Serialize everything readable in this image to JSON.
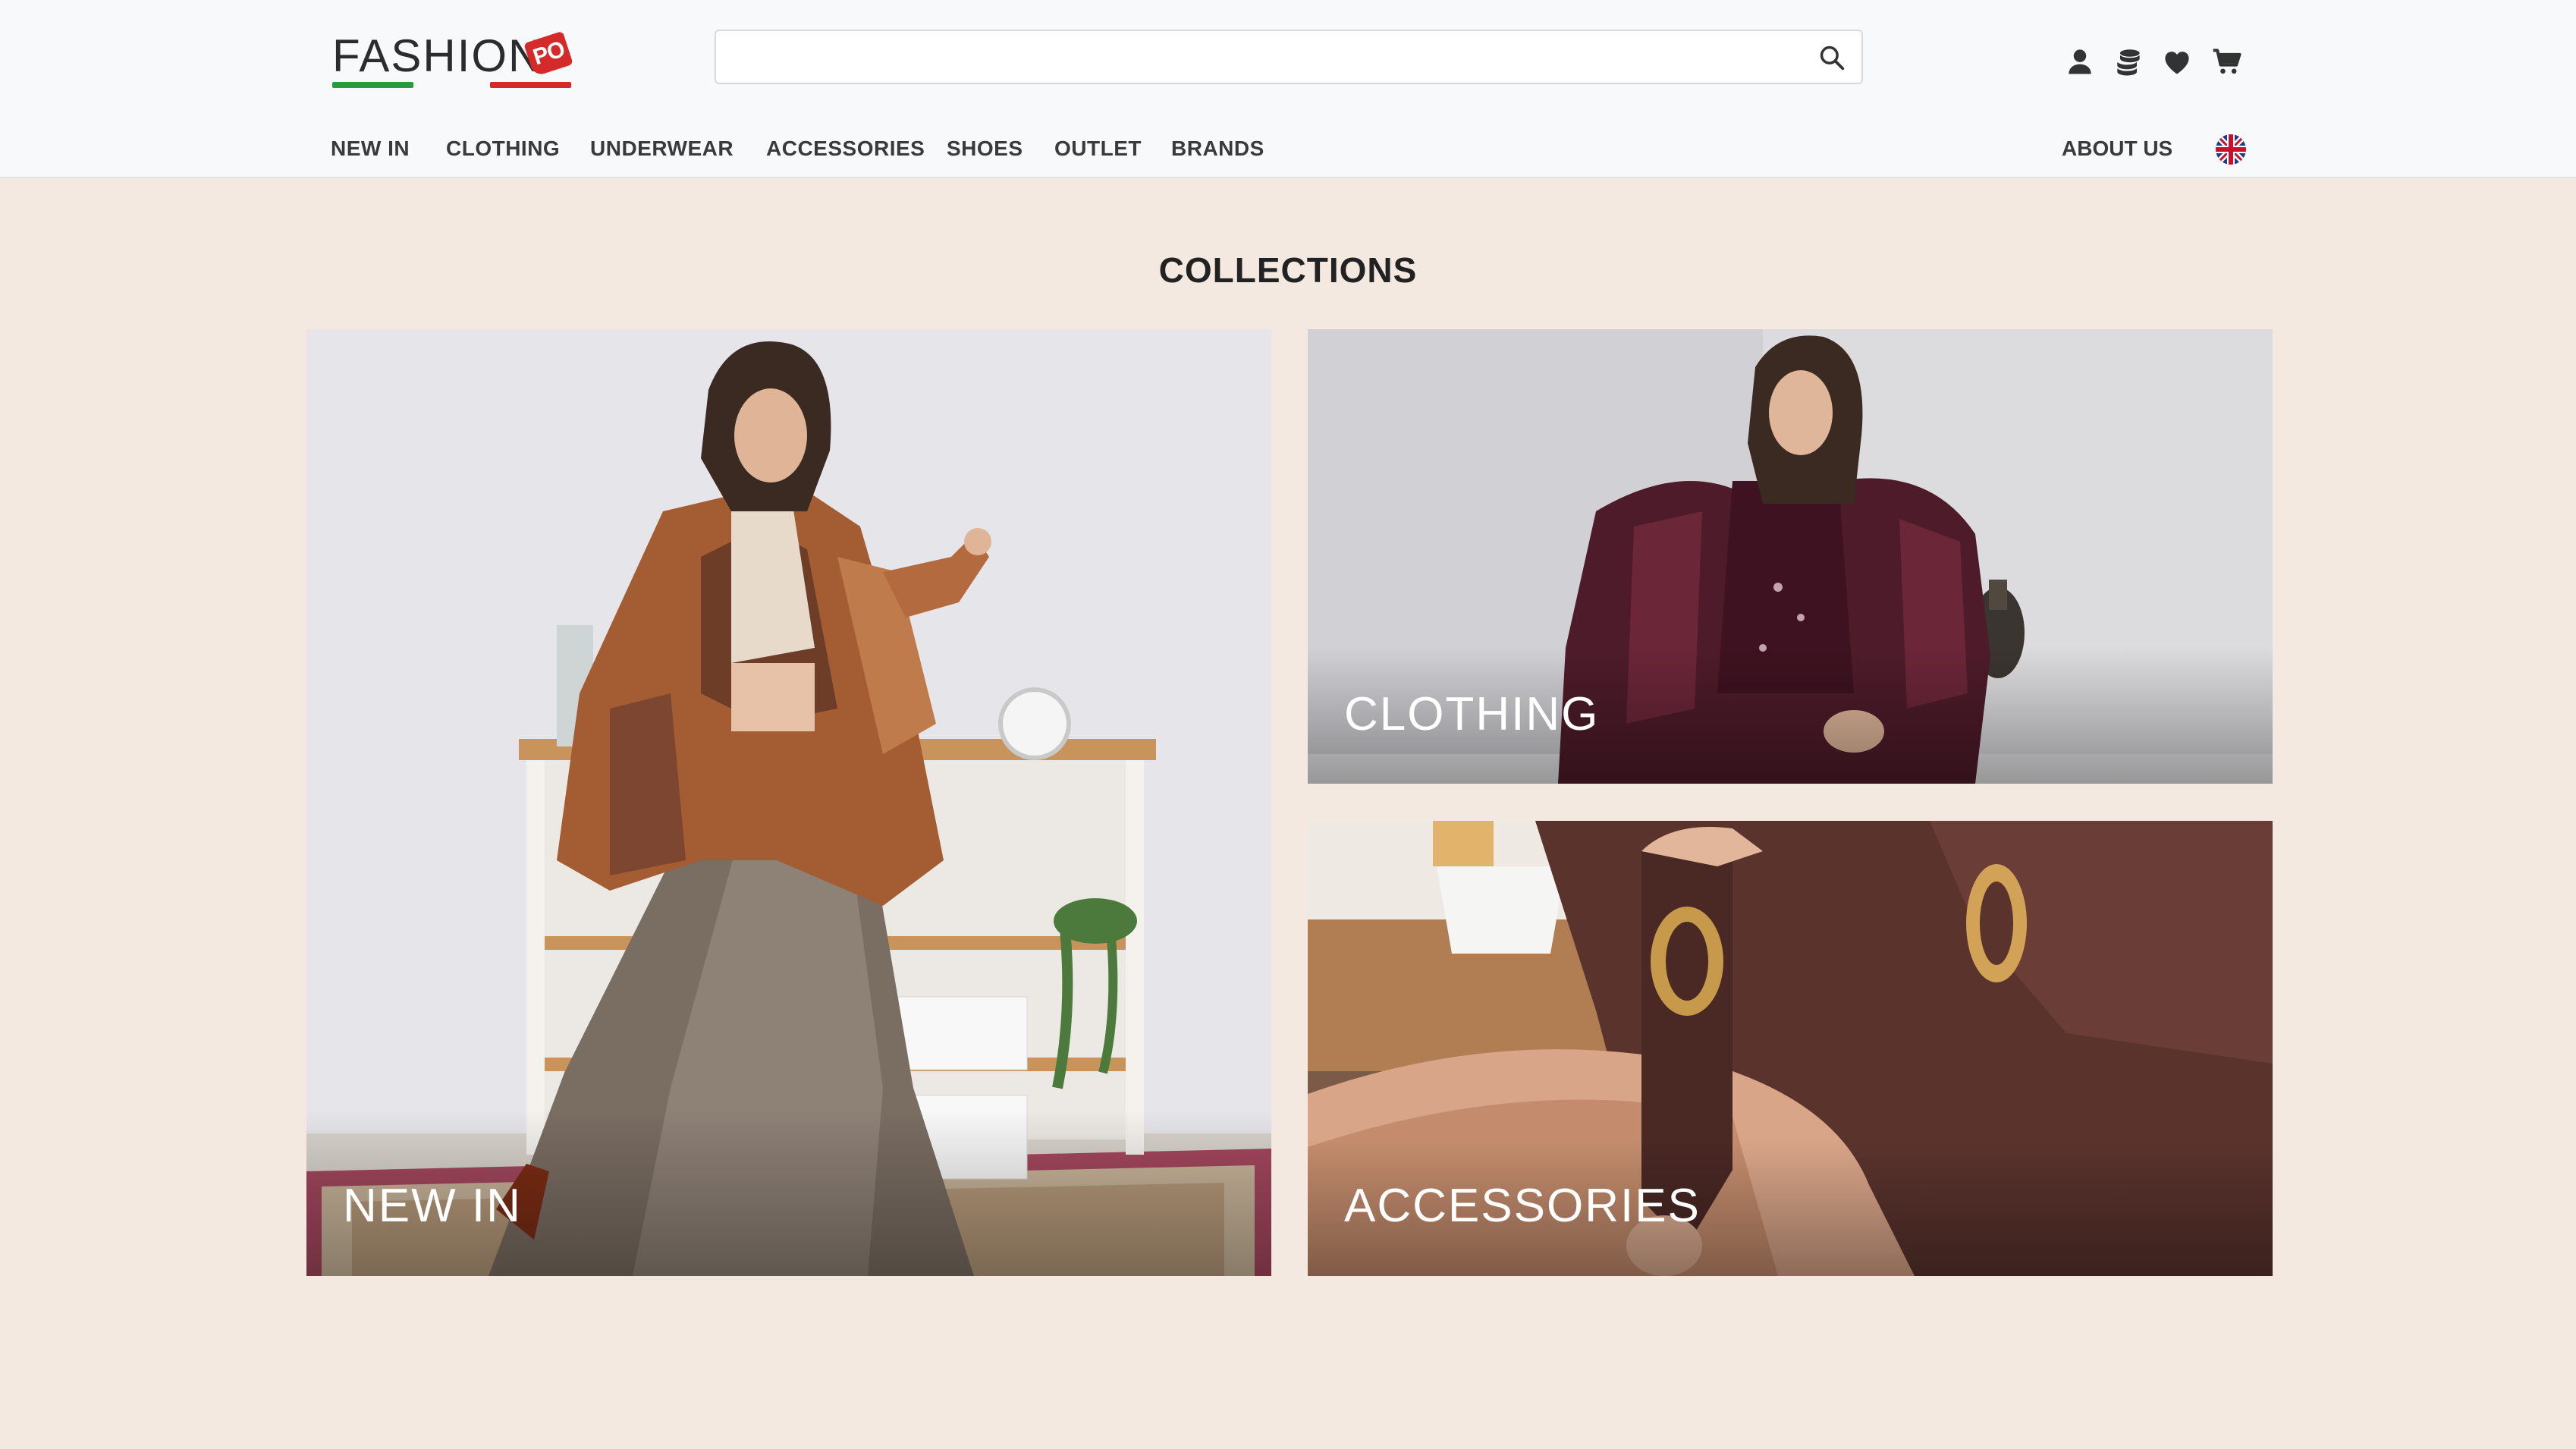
{
  "header": {
    "logo_text": "FASHION",
    "logo_tag": "PO",
    "search": {
      "placeholder": "",
      "value": ""
    },
    "icons": [
      "user-icon",
      "coins-icon",
      "heart-icon",
      "cart-icon"
    ],
    "nav": [
      "NEW IN",
      "CLOTHING",
      "UNDERWEAR",
      "ACCESSORIES",
      "SHOES",
      "OUTLET",
      "BRANDS"
    ],
    "about": "ABOUT US",
    "language_flag": "uk-flag-icon"
  },
  "main": {
    "title": "COLLECTIONS",
    "collections": [
      {
        "label": "NEW IN"
      },
      {
        "label": "CLOTHING"
      },
      {
        "label": "ACCESSORIES"
      }
    ]
  },
  "colors": {
    "page_background": "#f3e9e0",
    "header_background": "#f8f9fb",
    "logo_green": "#2a9a3e",
    "logo_red": "#d42a2a"
  }
}
